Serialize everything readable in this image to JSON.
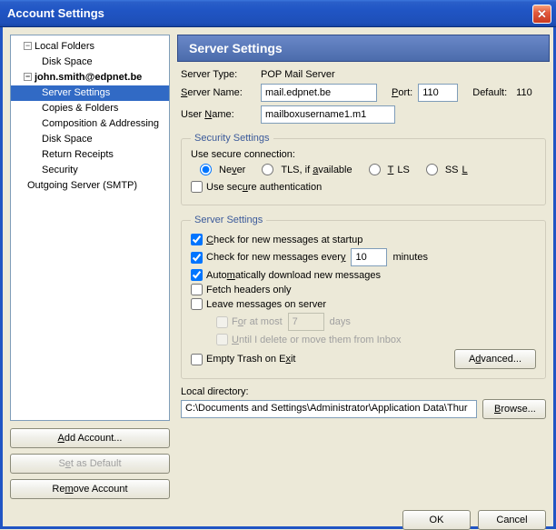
{
  "window": {
    "title": "Account Settings",
    "close": "X"
  },
  "tree": {
    "local_folders": "Local Folders",
    "disk_space": "Disk Space",
    "account": "john.smith@edpnet.be",
    "server_settings": "Server Settings",
    "copies": "Copies & Folders",
    "composition": "Composition & Addressing",
    "disk_space2": "Disk Space",
    "return": "Return Receipts",
    "security": "Security",
    "outgoing": "Outgoing Server (SMTP)"
  },
  "tree_buttons": {
    "add": "Add Account...",
    "set_default": "Set as Default",
    "remove": "Remove Account"
  },
  "header": "Server Settings",
  "fields": {
    "server_type_label": "Server Type:",
    "server_type_value": "POP Mail Server",
    "server_name_label": "Server Name:",
    "server_name_value": "mail.edpnet.be",
    "port_label": "Port:",
    "port_value": "110",
    "default_label": "Default:",
    "default_value": "110",
    "user_name_label": "User Name:",
    "user_name_value": "mailboxusername1.m1"
  },
  "security": {
    "legend": "Security Settings",
    "use_secure_label": "Use secure connection:",
    "never": "Never",
    "tls_if": "TLS, if available",
    "tls": "TLS",
    "ssl": "SSL",
    "secure_auth": "Use secure authentication",
    "selected": "never",
    "secure_auth_checked": false
  },
  "server_settings": {
    "legend": "Server Settings",
    "check_startup": "Check for new messages at startup",
    "check_every_prefix": "Check for new messages every",
    "check_every_value": "10",
    "check_every_suffix": "minutes",
    "auto_download": "Automatically download new messages",
    "fetch_headers": "Fetch headers only",
    "leave_on_server": "Leave messages on server",
    "for_at_most": "For at most",
    "for_at_most_value": "7",
    "days": "days",
    "until_delete": "Until I delete or move them from Inbox",
    "empty_trash": "Empty Trash on Exit",
    "advanced": "Advanced...",
    "check_startup_checked": true,
    "check_every_checked": true,
    "auto_download_checked": true,
    "fetch_headers_checked": false,
    "leave_on_server_checked": false,
    "empty_trash_checked": false
  },
  "local": {
    "label": "Local directory:",
    "path": "C:\\Documents and Settings\\Administrator\\Application Data\\Thur",
    "browse": "Browse..."
  },
  "buttons": {
    "ok": "OK",
    "cancel": "Cancel"
  }
}
